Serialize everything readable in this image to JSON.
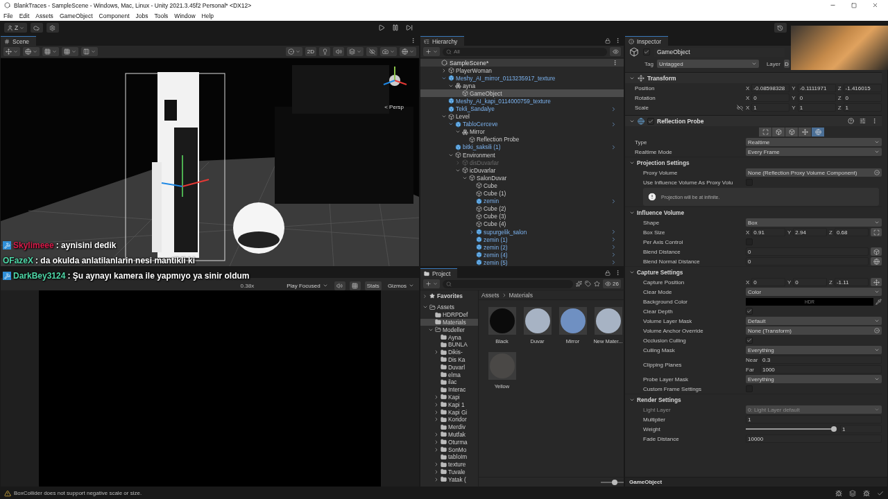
{
  "window": {
    "title": "BlankTraces - SampleScene - Windows, Mac, Linux - Unity 2021.3.45f2 Personal* <DX12>"
  },
  "menu": [
    "File",
    "Edit",
    "Assets",
    "GameObject",
    "Component",
    "Jobs",
    "Tools",
    "Window",
    "Help"
  ],
  "toolbar": {
    "account": "Z"
  },
  "scene": {
    "tab": "Scene",
    "mode_2d": "2D",
    "view_label": "< Persp"
  },
  "chat": [
    {
      "user": "Skylimeee",
      "color": "#d81b4a",
      "badge": true,
      "text": ": aynisini dedik"
    },
    {
      "user": "OFazeX",
      "color": "#4fd8a8",
      "badge": false,
      "text": ": da okulda anlatilanlarin nesi mantikli ki"
    },
    {
      "user": "DarkBey3124",
      "color": "#4fd8a8",
      "badge": true,
      "text": ": Şu aynayı kamera ile yapmıyo ya sinir oldum"
    }
  ],
  "game": {
    "scale": "0.38x",
    "play_mode": "Play Focused",
    "stats": "Stats",
    "gizmos": "Gizmos"
  },
  "hierarchy": {
    "tab": "Hierarchy",
    "search": {
      "placeholder": "All"
    },
    "scene": "SampleScene*",
    "items": [
      {
        "name": "PlayerWoman",
        "kind": "object",
        "expanded": false,
        "selected": false
      },
      {
        "name": "Meshy_AI_mirror_0113235917_texture",
        "kind": "prefab",
        "expanded": true,
        "selected": false,
        "children": [
          {
            "name": "ayna",
            "kind": "variant",
            "expanded": true,
            "selected": false,
            "children": [
              {
                "name": "GameObject",
                "kind": "object",
                "selected": true
              }
            ]
          }
        ]
      },
      {
        "name": "Meshy_AI_kapi_0114000759_texture",
        "kind": "prefab",
        "selected": false
      },
      {
        "name": "Tekli_Sandalye",
        "kind": "prefab",
        "chevron": true,
        "selected": false
      },
      {
        "name": "Level",
        "kind": "object",
        "expanded": true,
        "selected": false,
        "children": [
          {
            "name": "TabloCerceve",
            "kind": "prefab",
            "chevron": true,
            "expanded": true,
            "selected": false,
            "children": [
              {
                "name": "Mirror",
                "kind": "variant",
                "expanded": true,
                "selected": false,
                "children": [
                  {
                    "name": "Reflection Probe",
                    "kind": "object",
                    "selected": false
                  }
                ]
              }
            ]
          },
          {
            "name": "bitki_saksili (1)",
            "kind": "prefab",
            "chevron": true,
            "selected": false
          },
          {
            "name": "Environment",
            "kind": "object",
            "expanded": true,
            "selected": false,
            "children": [
              {
                "name": "disDuvarlar",
                "kind": "object",
                "expanded": false,
                "inactive": true,
                "selected": false
              },
              {
                "name": "icDuvarlar",
                "kind": "object",
                "expanded": true,
                "inactive": false,
                "selected": false,
                "children": [
                  {
                    "name": "SalonDuvar",
                    "kind": "object",
                    "expanded": true,
                    "selected": false,
                    "children": [
                      {
                        "name": "Cube",
                        "kind": "object",
                        "selected": false
                      },
                      {
                        "name": "Cube (1)",
                        "kind": "object",
                        "selected": false
                      },
                      {
                        "name": "zemin",
                        "kind": "prefab",
                        "chevron": true,
                        "selected": false
                      },
                      {
                        "name": "Cube (2)",
                        "kind": "object",
                        "selected": false
                      },
                      {
                        "name": "Cube (3)",
                        "kind": "object",
                        "selected": false
                      },
                      {
                        "name": "Cube (4)",
                        "kind": "object",
                        "selected": false
                      },
                      {
                        "name": "supurgelik_salon",
                        "kind": "prefab",
                        "chevron": true,
                        "expanded": false,
                        "selected": false
                      },
                      {
                        "name": "zemin (1)",
                        "kind": "prefab",
                        "chevron": true,
                        "selected": false
                      },
                      {
                        "name": "zemin (2)",
                        "kind": "prefab",
                        "chevron": true,
                        "selected": false
                      },
                      {
                        "name": "zemin (4)",
                        "kind": "prefab",
                        "chevron": true,
                        "selected": false
                      },
                      {
                        "name": "zemin (5)",
                        "kind": "prefab",
                        "chevron": true,
                        "selected": false
                      }
                    ]
                  }
                ]
              }
            ]
          }
        ]
      }
    ]
  },
  "project": {
    "tab": "Project",
    "count": "26",
    "favorites": "Favorites",
    "breadcrumb": [
      "Assets",
      "Materials"
    ],
    "tree": [
      {
        "name": "Assets",
        "expanded": true,
        "selected": false,
        "children": [
          {
            "name": "HDRPDef",
            "selected": false
          },
          {
            "name": "Materials",
            "selected": true
          },
          {
            "name": "Modeller",
            "expanded": true,
            "selected": false,
            "children": [
              {
                "name": "Ayna",
                "selected": false
              },
              {
                "name": "BUNLA",
                "selected": false
              },
              {
                "name": "Dikis-",
                "expanded": false,
                "selected": false
              },
              {
                "name": "Dis Ka",
                "selected": false
              },
              {
                "name": "Duvarl",
                "selected": false
              },
              {
                "name": "elma",
                "selected": false
              },
              {
                "name": "ilac",
                "selected": false
              },
              {
                "name": "Interac",
                "selected": false
              },
              {
                "name": "Kapi",
                "expanded": false,
                "selected": false
              },
              {
                "name": "Kapi 1",
                "expanded": false,
                "selected": false
              },
              {
                "name": "Kapi Gi",
                "expanded": false,
                "selected": false
              },
              {
                "name": "Koridor",
                "expanded": false,
                "selected": false
              },
              {
                "name": "Merdiv",
                "selected": false
              },
              {
                "name": "Mutfak",
                "expanded": false,
                "selected": false
              },
              {
                "name": "Oturma",
                "expanded": false,
                "selected": false
              },
              {
                "name": "SonMo",
                "expanded": false,
                "selected": false
              },
              {
                "name": "tabloIm",
                "selected": false
              },
              {
                "name": "texture",
                "expanded": false,
                "selected": false
              },
              {
                "name": "Tuvale",
                "expanded": false,
                "selected": false
              },
              {
                "name": "Yatak (",
                "expanded": false,
                "selected": false
              }
            ]
          }
        ]
      }
    ],
    "materials": [
      {
        "name": "Black",
        "color": "#0b0b0b"
      },
      {
        "name": "Duvar",
        "color": "#a7b3c4"
      },
      {
        "name": "Mirror",
        "color": "#6f90c2"
      },
      {
        "name": "New Mater...",
        "color": "#a7b3c4"
      },
      {
        "name": "Yellow",
        "color": "#4a4846"
      }
    ],
    "zoom": {
      "level": 0.55
    }
  },
  "inspector": {
    "tab": "Inspector",
    "object": {
      "active": true,
      "name": "GameObject",
      "tag_label": "Tag",
      "tag": "Untagged",
      "layer_label": "Layer",
      "layer": "D"
    },
    "components": [
      {
        "kind": "transform",
        "title": "Transform",
        "expanded": true,
        "rows": [
          {
            "kind": "vector3",
            "label": "Position",
            "axes": [
              {
                "axis": "X",
                "value": "-0.08598328"
              },
              {
                "axis": "Y",
                "value": "-0.1111971"
              },
              {
                "axis": "Z",
                "value": "-1.416015"
              }
            ]
          },
          {
            "kind": "vector3",
            "label": "Rotation",
            "axes": [
              {
                "axis": "X",
                "value": "0"
              },
              {
                "axis": "Y",
                "value": "0"
              },
              {
                "axis": "Z",
                "value": "0"
              }
            ]
          },
          {
            "kind": "vector3",
            "label": "Scale",
            "linked": false,
            "axes": [
              {
                "axis": "X",
                "value": "1"
              },
              {
                "axis": "Y",
                "value": "1"
              },
              {
                "axis": "Z",
                "value": "1"
              }
            ]
          }
        ]
      },
      {
        "kind": "probe",
        "title": "Reflection Probe",
        "enabled": true,
        "expanded": true,
        "modes": [
          {
            "selected": false
          },
          {
            "selected": false
          },
          {
            "selected": false
          },
          {
            "selected": false
          },
          {
            "selected": true
          }
        ],
        "rows": [
          {
            "kind": "dropdown",
            "label": "Type",
            "value": "Realtime"
          },
          {
            "kind": "dropdown",
            "label": "Realtime Mode",
            "value": "Every Frame"
          },
          {
            "kind": "section",
            "label": "Projection Settings",
            "expanded": true,
            "rows": [
              {
                "kind": "object",
                "label": "Proxy Volume",
                "value": "None (Reflection Proxy Volume Component)"
              },
              {
                "kind": "checkbox",
                "label": "Use Influence Volume As Proxy Volu",
                "checked": false
              },
              {
                "kind": "help",
                "text": "Projection will be at infinite."
              }
            ]
          },
          {
            "kind": "section",
            "label": "Influence Volume",
            "expanded": true,
            "rows": [
              {
                "kind": "dropdown",
                "label": "Shape",
                "value": "Box"
              },
              {
                "kind": "vector3",
                "label": "Box Size",
                "tool": {
                  "kind": "edit"
                },
                "axes": [
                  {
                    "axis": "X",
                    "value": "0.91"
                  },
                  {
                    "axis": "Y",
                    "value": "2.94"
                  },
                  {
                    "axis": "Z",
                    "value": "0.68"
                  }
                ]
              },
              {
                "kind": "checkbox",
                "label": "Per Axis Control",
                "checked": false
              },
              {
                "kind": "field",
                "label": "Blend Distance",
                "value": "0",
                "tool": {
                  "kind": "cube"
                }
              },
              {
                "kind": "field",
                "label": "Blend Normal Distance",
                "value": "0",
                "tool": {
                  "kind": "sphere"
                }
              }
            ]
          },
          {
            "kind": "section",
            "label": "Capture Settings",
            "expanded": true,
            "rows": [
              {
                "kind": "vector3",
                "label": "Capture Position",
                "tool": {
                  "kind": "move"
                },
                "axes": [
                  {
                    "axis": "X",
                    "value": "0"
                  },
                  {
                    "axis": "Y",
                    "value": "0"
                  },
                  {
                    "axis": "Z",
                    "value": "-1.11"
                  }
                ]
              },
              {
                "kind": "dropdown",
                "label": "Clear Mode",
                "value": "Color"
              },
              {
                "kind": "color",
                "label": "Background Color",
                "color": "#000000",
                "value": "HDR"
              },
              {
                "kind": "checkbox",
                "label": "Clear Depth",
                "checked": true
              },
              {
                "kind": "dropdown",
                "label": "Volume Layer Mask",
                "value": "Default"
              },
              {
                "kind": "object",
                "label": "Volume Anchor Override",
                "value": "None (Transform)"
              },
              {
                "kind": "checkbox",
                "label": "Occlusion Culling",
                "checked": true
              },
              {
                "kind": "dropdown",
                "label": "Culling Mask",
                "value": "Everything"
              },
              {
                "kind": "planes",
                "label": "Clipping Planes",
                "parts": [
                  {
                    "axis": "Near",
                    "value": "0.3"
                  },
                  {
                    "axis": "Far",
                    "value": "1000"
                  }
                ]
              },
              {
                "kind": "dropdown",
                "label": "Probe Layer Mask",
                "value": "Everything"
              },
              {
                "kind": "checkbox",
                "label": "Custom Frame Settings",
                "checked": false
              }
            ]
          },
          {
            "kind": "section",
            "label": "Render Settings",
            "expanded": true,
            "rows": [
              {
                "kind": "dropdown",
                "label": "Light Layer",
                "value": "0: Light Layer default",
                "disabled": true
              },
              {
                "kind": "field",
                "label": "Multiplier",
                "value": "1",
                "disabled": false
              },
              {
                "kind": "slider",
                "label": "Weight",
                "level": 1,
                "value": "1",
                "disabled": false
              },
              {
                "kind": "field",
                "label": "Fade Distance",
                "value": "10000",
                "disabled": false
              }
            ]
          }
        ]
      }
    ],
    "footer": "GameObject"
  },
  "status": {
    "message": "BoxCollider does not support negative scale or size."
  }
}
